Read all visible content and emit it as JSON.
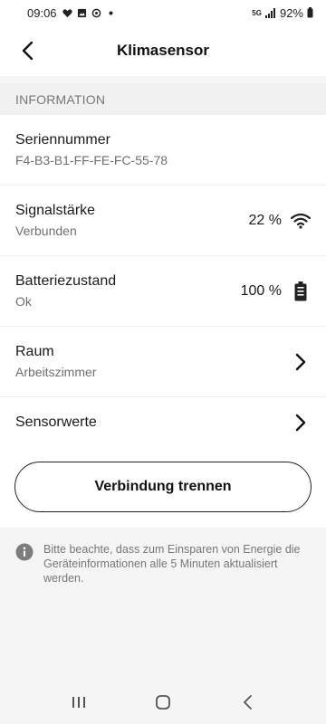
{
  "status_bar": {
    "time": "09:06",
    "network": "5G",
    "battery": "92%"
  },
  "app_bar": {
    "title": "Klimasensor"
  },
  "section": {
    "header": "INFORMATION"
  },
  "rows": [
    {
      "primary": "Seriennummer",
      "secondary": "F4-B3-B1-FF-FE-FC-55-78"
    },
    {
      "primary": "Signalstärke",
      "secondary": "Verbunden",
      "value": "22 %"
    },
    {
      "primary": "Batteriezustand",
      "secondary": "Ok",
      "value": "100 %"
    },
    {
      "primary": "Raum",
      "secondary": "Arbeitszimmer"
    },
    {
      "primary": "Sensorwerte"
    }
  ],
  "disconnect_button": "Verbindung trennen",
  "info_note": "Bitte beachte, dass zum Einsparen von Energie die Geräteinformationen alle 5 Minuten aktualisiert werden."
}
